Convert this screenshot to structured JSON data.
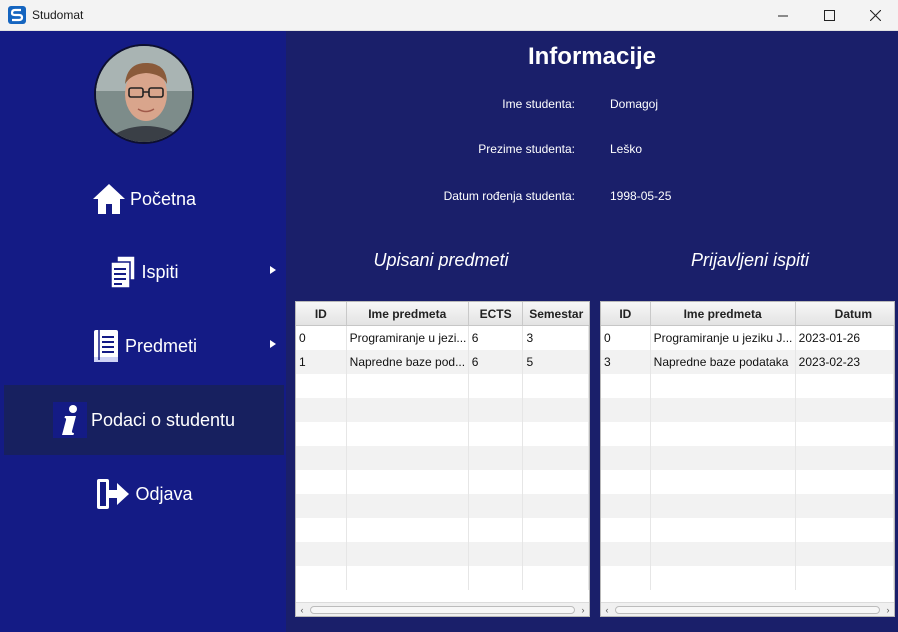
{
  "window": {
    "title": "Studomat"
  },
  "sidebar": {
    "items": [
      {
        "label": "Početna",
        "icon": "home-icon",
        "has_arrow": false,
        "active": false
      },
      {
        "label": "Ispiti",
        "icon": "documents-icon",
        "has_arrow": true,
        "active": false
      },
      {
        "label": "Predmeti",
        "icon": "book-icon",
        "has_arrow": true,
        "active": false
      },
      {
        "label": "Podaci o studentu",
        "icon": "info-icon",
        "has_arrow": false,
        "active": true
      },
      {
        "label": "Odjava",
        "icon": "logout-icon",
        "has_arrow": false,
        "active": false
      }
    ]
  },
  "main": {
    "heading": "Informacije",
    "info": [
      {
        "label": "Ime studenta:",
        "value": "Domagoj"
      },
      {
        "label": "Prezime studenta:",
        "value": "Leško"
      },
      {
        "label": "Datum rođenja studenta:",
        "value": "1998-05-25"
      }
    ],
    "enrolled": {
      "title": "Upisani predmeti",
      "columns": [
        "ID",
        "Ime predmeta",
        "ECTS",
        "Semestar"
      ],
      "rows": [
        [
          "0",
          "Programiranje u jezi...",
          "6",
          "3"
        ],
        [
          "1",
          "Napredne baze pod...",
          "6",
          "5"
        ]
      ]
    },
    "exams": {
      "title": "Prijavljeni ispiti",
      "columns": [
        "ID",
        "Ime predmeta",
        "Datum"
      ],
      "rows": [
        [
          "0",
          "Programiranje u jeziku J...",
          "2023-01-26"
        ],
        [
          "3",
          "Napredne baze podataka",
          "2023-02-23"
        ]
      ]
    }
  },
  "colors": {
    "sidebar": "#141b85",
    "main": "#1a1f6a",
    "active_item": "#17205f"
  }
}
